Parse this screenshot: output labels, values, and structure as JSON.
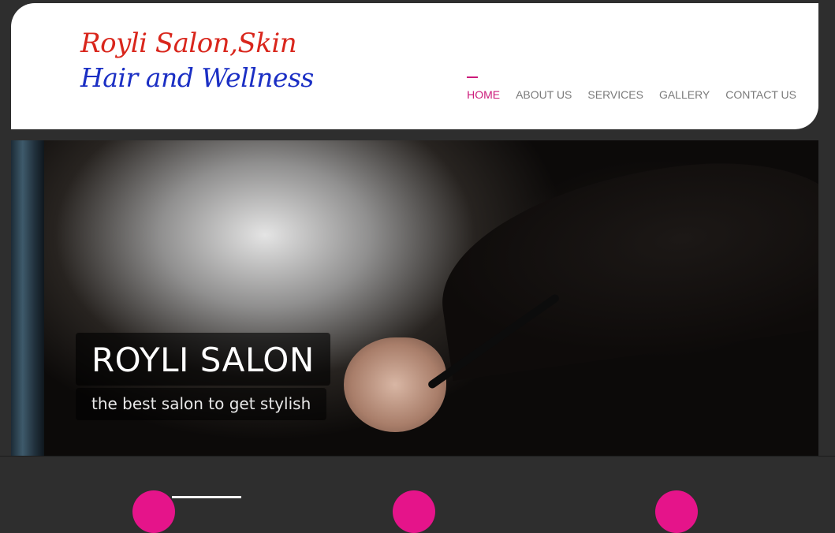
{
  "logo": {
    "line1": "Royli Salon,Skin",
    "line2": "Hair and Wellness"
  },
  "nav": {
    "items": [
      {
        "label": "HOME",
        "active": true
      },
      {
        "label": "ABOUT US",
        "active": false
      },
      {
        "label": "SERVICES",
        "active": false
      },
      {
        "label": "GALLERY",
        "active": false
      },
      {
        "label": "CONTACT US",
        "active": false
      }
    ]
  },
  "hero": {
    "title": "ROYLI SALON",
    "subtitle": "the best salon to get stylish"
  },
  "colors": {
    "accent": "#cc1a7a",
    "logo_red": "#d9261c",
    "logo_blue": "#1b2fc4",
    "circle_pink": "#e5148a",
    "background": "#2e2e2e"
  }
}
